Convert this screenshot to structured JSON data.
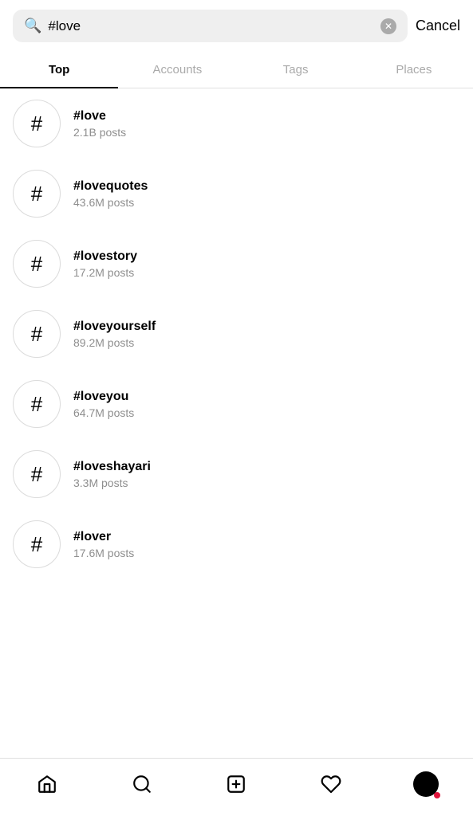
{
  "search": {
    "query": "#love",
    "placeholder": "Search",
    "clear_label": "×",
    "cancel_label": "Cancel"
  },
  "tabs": [
    {
      "id": "top",
      "label": "Top",
      "active": true
    },
    {
      "id": "accounts",
      "label": "Accounts",
      "active": false
    },
    {
      "id": "tags",
      "label": "Tags",
      "active": false
    },
    {
      "id": "places",
      "label": "Places",
      "active": false
    }
  ],
  "results": [
    {
      "tag": "#love",
      "posts": "2.1B posts"
    },
    {
      "tag": "#lovequotes",
      "posts": "43.6M posts"
    },
    {
      "tag": "#lovestory",
      "posts": "17.2M posts"
    },
    {
      "tag": "#loveyourself",
      "posts": "89.2M posts"
    },
    {
      "tag": "#loveyou",
      "posts": "64.7M posts"
    },
    {
      "tag": "#loveshayari",
      "posts": "3.3M posts"
    },
    {
      "tag": "#lover",
      "posts": "17.6M posts"
    }
  ],
  "nav": {
    "home_label": "Home",
    "search_label": "Search",
    "new_label": "New Post",
    "activity_label": "Activity",
    "profile_label": "Profile"
  }
}
